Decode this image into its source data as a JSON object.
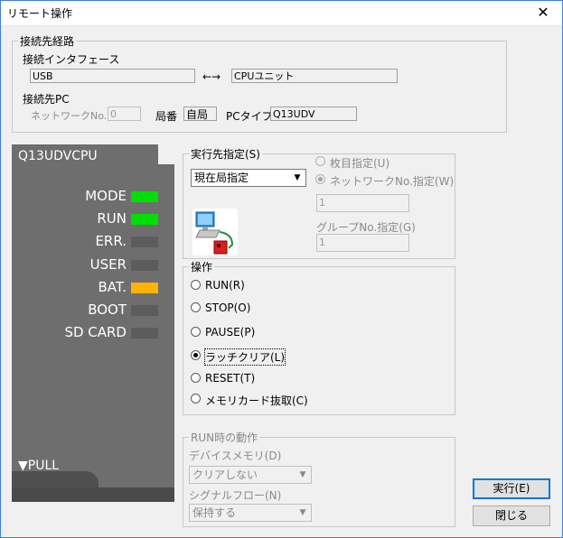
{
  "window": {
    "title": "リモート操作",
    "close_glyph": "✕"
  },
  "route": {
    "legend": "接続先経路",
    "interface_label": "接続インタフェース",
    "interface_value": "USB",
    "arrow": "←→",
    "target_value": "CPUユニット",
    "pc_label": "接続先PC",
    "network_label": "ネットワークNo.",
    "network_value": "0",
    "station_label": "局番",
    "station_value": "自局",
    "pc_type_label": "PCタイプ",
    "pc_type_value": "Q13UDV"
  },
  "plc": {
    "model": "Q13UDVCPU",
    "leds": [
      {
        "label": "MODE",
        "color": "#00e000"
      },
      {
        "label": "RUN",
        "color": "#00e000"
      },
      {
        "label": "ERR.",
        "color": "#5c5c5c"
      },
      {
        "label": "USER",
        "color": "#5c5c5c"
      },
      {
        "label": "BAT.",
        "color": "#ffb300"
      },
      {
        "label": "BOOT",
        "color": "#5c5c5c"
      },
      {
        "label": "SD CARD",
        "color": "#5c5c5c"
      }
    ],
    "pull_label": "▼PULL"
  },
  "exec_target": {
    "legend": "実行先指定(S)",
    "combo_value": "現在局指定",
    "option_count": "枚目指定(U)",
    "option_network": "ネットワークNo.指定(W)",
    "network_value": "1",
    "group_label": "グループNo.指定(G)",
    "group_value": "1"
  },
  "operation": {
    "legend": "操作",
    "options": [
      "RUN(R)",
      "STOP(O)",
      "PAUSE(P)",
      "ラッチクリア(L)",
      "RESET(T)",
      "メモリカード抜取(C)"
    ],
    "selected_index": 3
  },
  "run_behavior": {
    "legend": "RUN時の動作",
    "device_label": "デバイスメモリ(D)",
    "device_value": "クリアしない",
    "signal_label": "シグナルフロー(N)",
    "signal_value": "保持する"
  },
  "buttons": {
    "execute": "実行(E)",
    "close": "閉じる"
  }
}
